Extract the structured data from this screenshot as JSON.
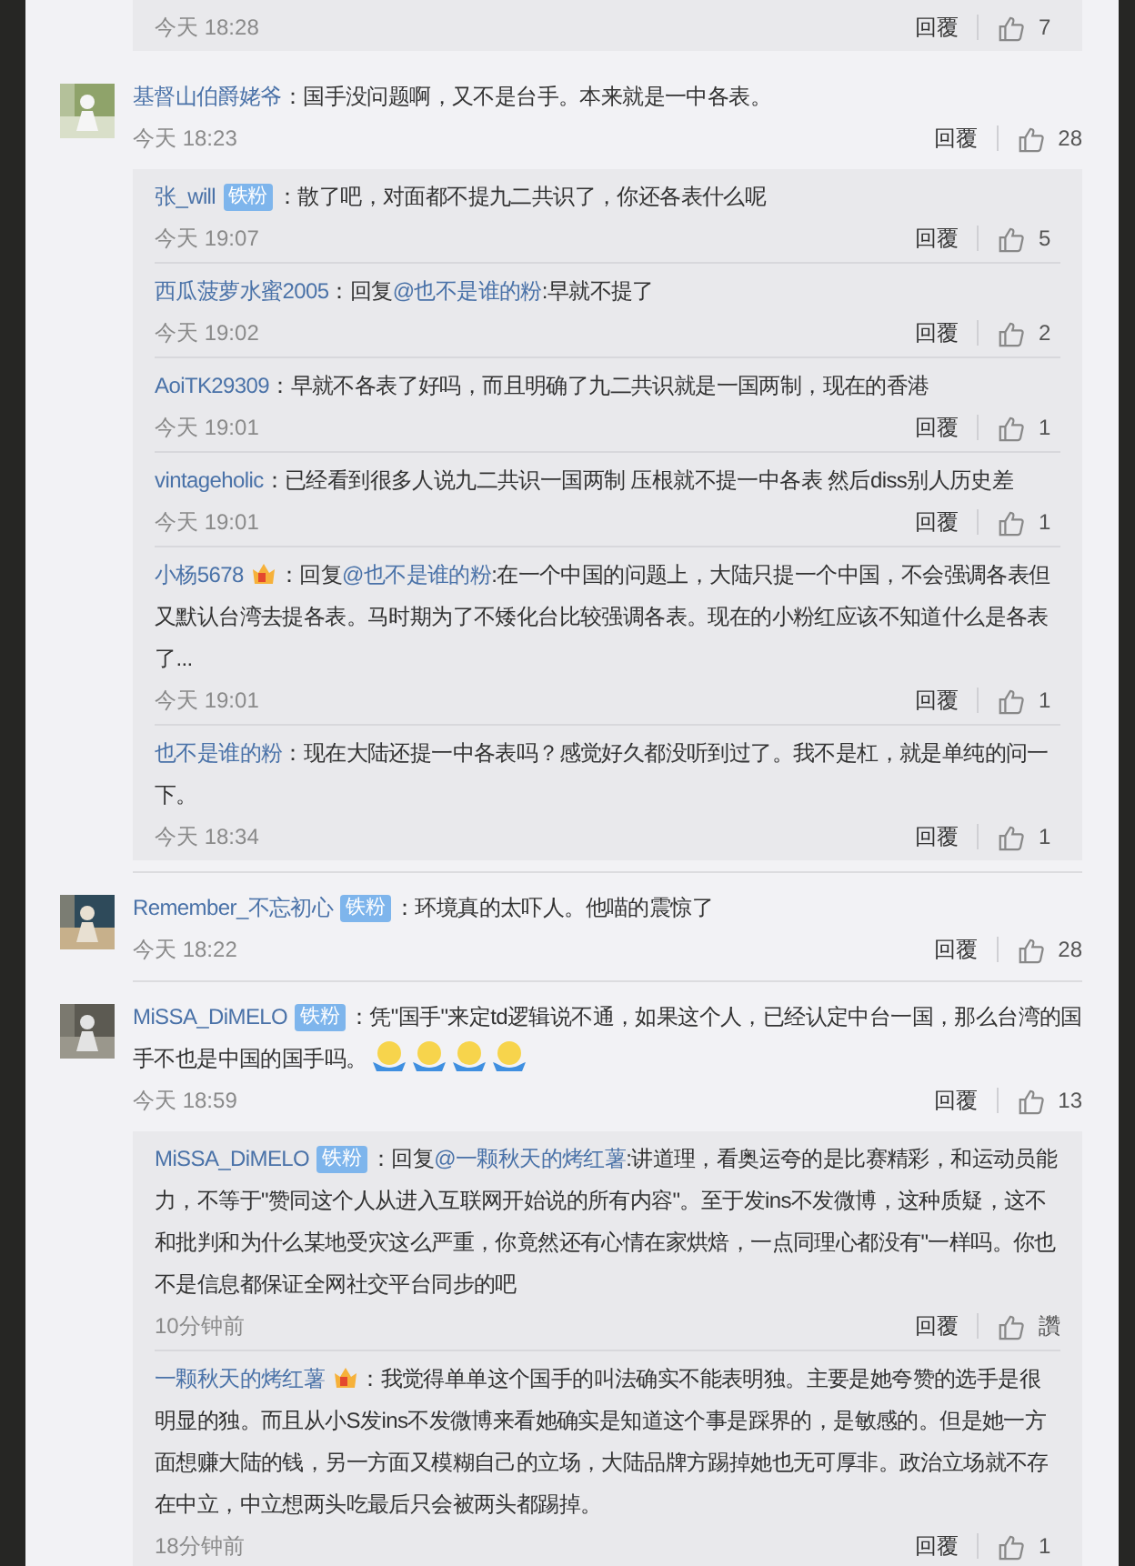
{
  "comments": [
    {
      "kind": "reply_tail",
      "time": "今天 18:28",
      "reply_label": "回覆",
      "likes": "7"
    },
    {
      "kind": "comment",
      "user": "基督山伯爵姥爷",
      "content": [
        {
          "kind": "text",
          "text": "：国手没问题啊，又不是台手。本来就是一中各表。"
        }
      ],
      "time": "今天 18:23",
      "reply_label": "回覆",
      "likes": "28",
      "replies": [
        {
          "user": "张_will",
          "badge": "铁粉",
          "content": [
            {
              "kind": "text",
              "text": "：散了吧，对面都不提九二共识了，你还各表什么呢"
            }
          ],
          "time": "今天 19:07",
          "reply_label": "回覆",
          "likes": "5"
        },
        {
          "user": "西瓜菠萝水蜜2005",
          "content": [
            {
              "kind": "text",
              "text": "：回复"
            },
            {
              "kind": "mention",
              "text": "@也不是谁的粉"
            },
            {
              "kind": "text",
              "text": ":早就不提了"
            }
          ],
          "time": "今天 19:02",
          "reply_label": "回覆",
          "likes": "2"
        },
        {
          "user": "AoiTK29309",
          "content": [
            {
              "kind": "text",
              "text": "：早就不各表了好吗，而且明确了九二共识就是一国两制，现在的香港"
            }
          ],
          "time": "今天 19:01",
          "reply_label": "回覆",
          "likes": "1"
        },
        {
          "user": "vintageholic",
          "content": [
            {
              "kind": "text",
              "text": "：已经看到很多人说九二共识一国两制 压根就不提一中各表 然后diss别人历史差"
            }
          ],
          "time": "今天 19:01",
          "reply_label": "回覆",
          "likes": "1"
        },
        {
          "user": "小杨5678",
          "vip": true,
          "content": [
            {
              "kind": "text",
              "text": "：回复"
            },
            {
              "kind": "mention",
              "text": "@也不是谁的粉"
            },
            {
              "kind": "text",
              "text": ":在一个中国的问题上，大陆只提一个中国，不会强调各表但又默认台湾去提各表。马时期为了不矮化台比较强调各表。现在的小粉红应该不知道什么是各表了..."
            }
          ],
          "time": "今天 19:01",
          "reply_label": "回覆",
          "likes": "1"
        },
        {
          "user": "也不是谁的粉",
          "content": [
            {
              "kind": "text",
              "text": "：现在大陆还提一中各表吗？感觉好久都没听到过了。我不是杠，就是单纯的问一下。"
            }
          ],
          "time": "今天 18:34",
          "reply_label": "回覆",
          "likes": "1"
        }
      ]
    },
    {
      "kind": "comment",
      "user": "Remember_不忘初心",
      "badge": "铁粉",
      "content": [
        {
          "kind": "text",
          "text": "：环境真的太吓人。他喵的震惊了"
        }
      ],
      "time": "今天 18:22",
      "reply_label": "回覆",
      "likes": "28"
    },
    {
      "kind": "comment",
      "user": "MiSSA_DiMELO",
      "badge": "铁粉",
      "content": [
        {
          "kind": "text",
          "text": "：凭\"国手\"来定td逻辑说不通，如果这个人，已经认定中台一国，那么台湾的国手不也是中国的国手吗。"
        },
        {
          "kind": "emoji"
        },
        {
          "kind": "emoji"
        },
        {
          "kind": "emoji"
        },
        {
          "kind": "emoji"
        }
      ],
      "time": "今天 18:59",
      "reply_label": "回覆",
      "likes": "13",
      "replies": [
        {
          "user": "MiSSA_DiMELO",
          "badge": "铁粉",
          "content": [
            {
              "kind": "text",
              "text": "：回复"
            },
            {
              "kind": "mention",
              "text": "@一颗秋天的烤红薯"
            },
            {
              "kind": "text",
              "text": ":讲道理，看奥运夸的是比赛精彩，和运动员能力，不等于\"赞同这个人从进入互联网开始说的所有内容\"。至于发ins不发微博，这种质疑，这不和批判和为什么某地受灾这么严重，你竟然还有心情在家烘焙，一点同理心都没有\"一样吗。你也不是信息都保证全网社交平台同步的吧"
            }
          ],
          "time": "10分钟前",
          "reply_label": "回覆",
          "likes": "讚"
        },
        {
          "user": "一颗秋天的烤红薯",
          "vip": true,
          "content": [
            {
              "kind": "text",
              "text": "：我觉得单单这个国手的叫法确实不能表明独。主要是她夸赞的选手是很明显的独。而且从小S发ins不发微博来看她确实是知道这个事是踩界的，是敏感的。但是她一方面想赚大陆的钱，另一方面又模糊自己的立场，大陆品牌方踢掉她也无可厚非。政治立场就不存在中立，中立想两头吃最后只会被两头都踢掉。"
            }
          ],
          "time": "18分钟前",
          "reply_label": "回覆",
          "likes": "1"
        }
      ]
    }
  ]
}
